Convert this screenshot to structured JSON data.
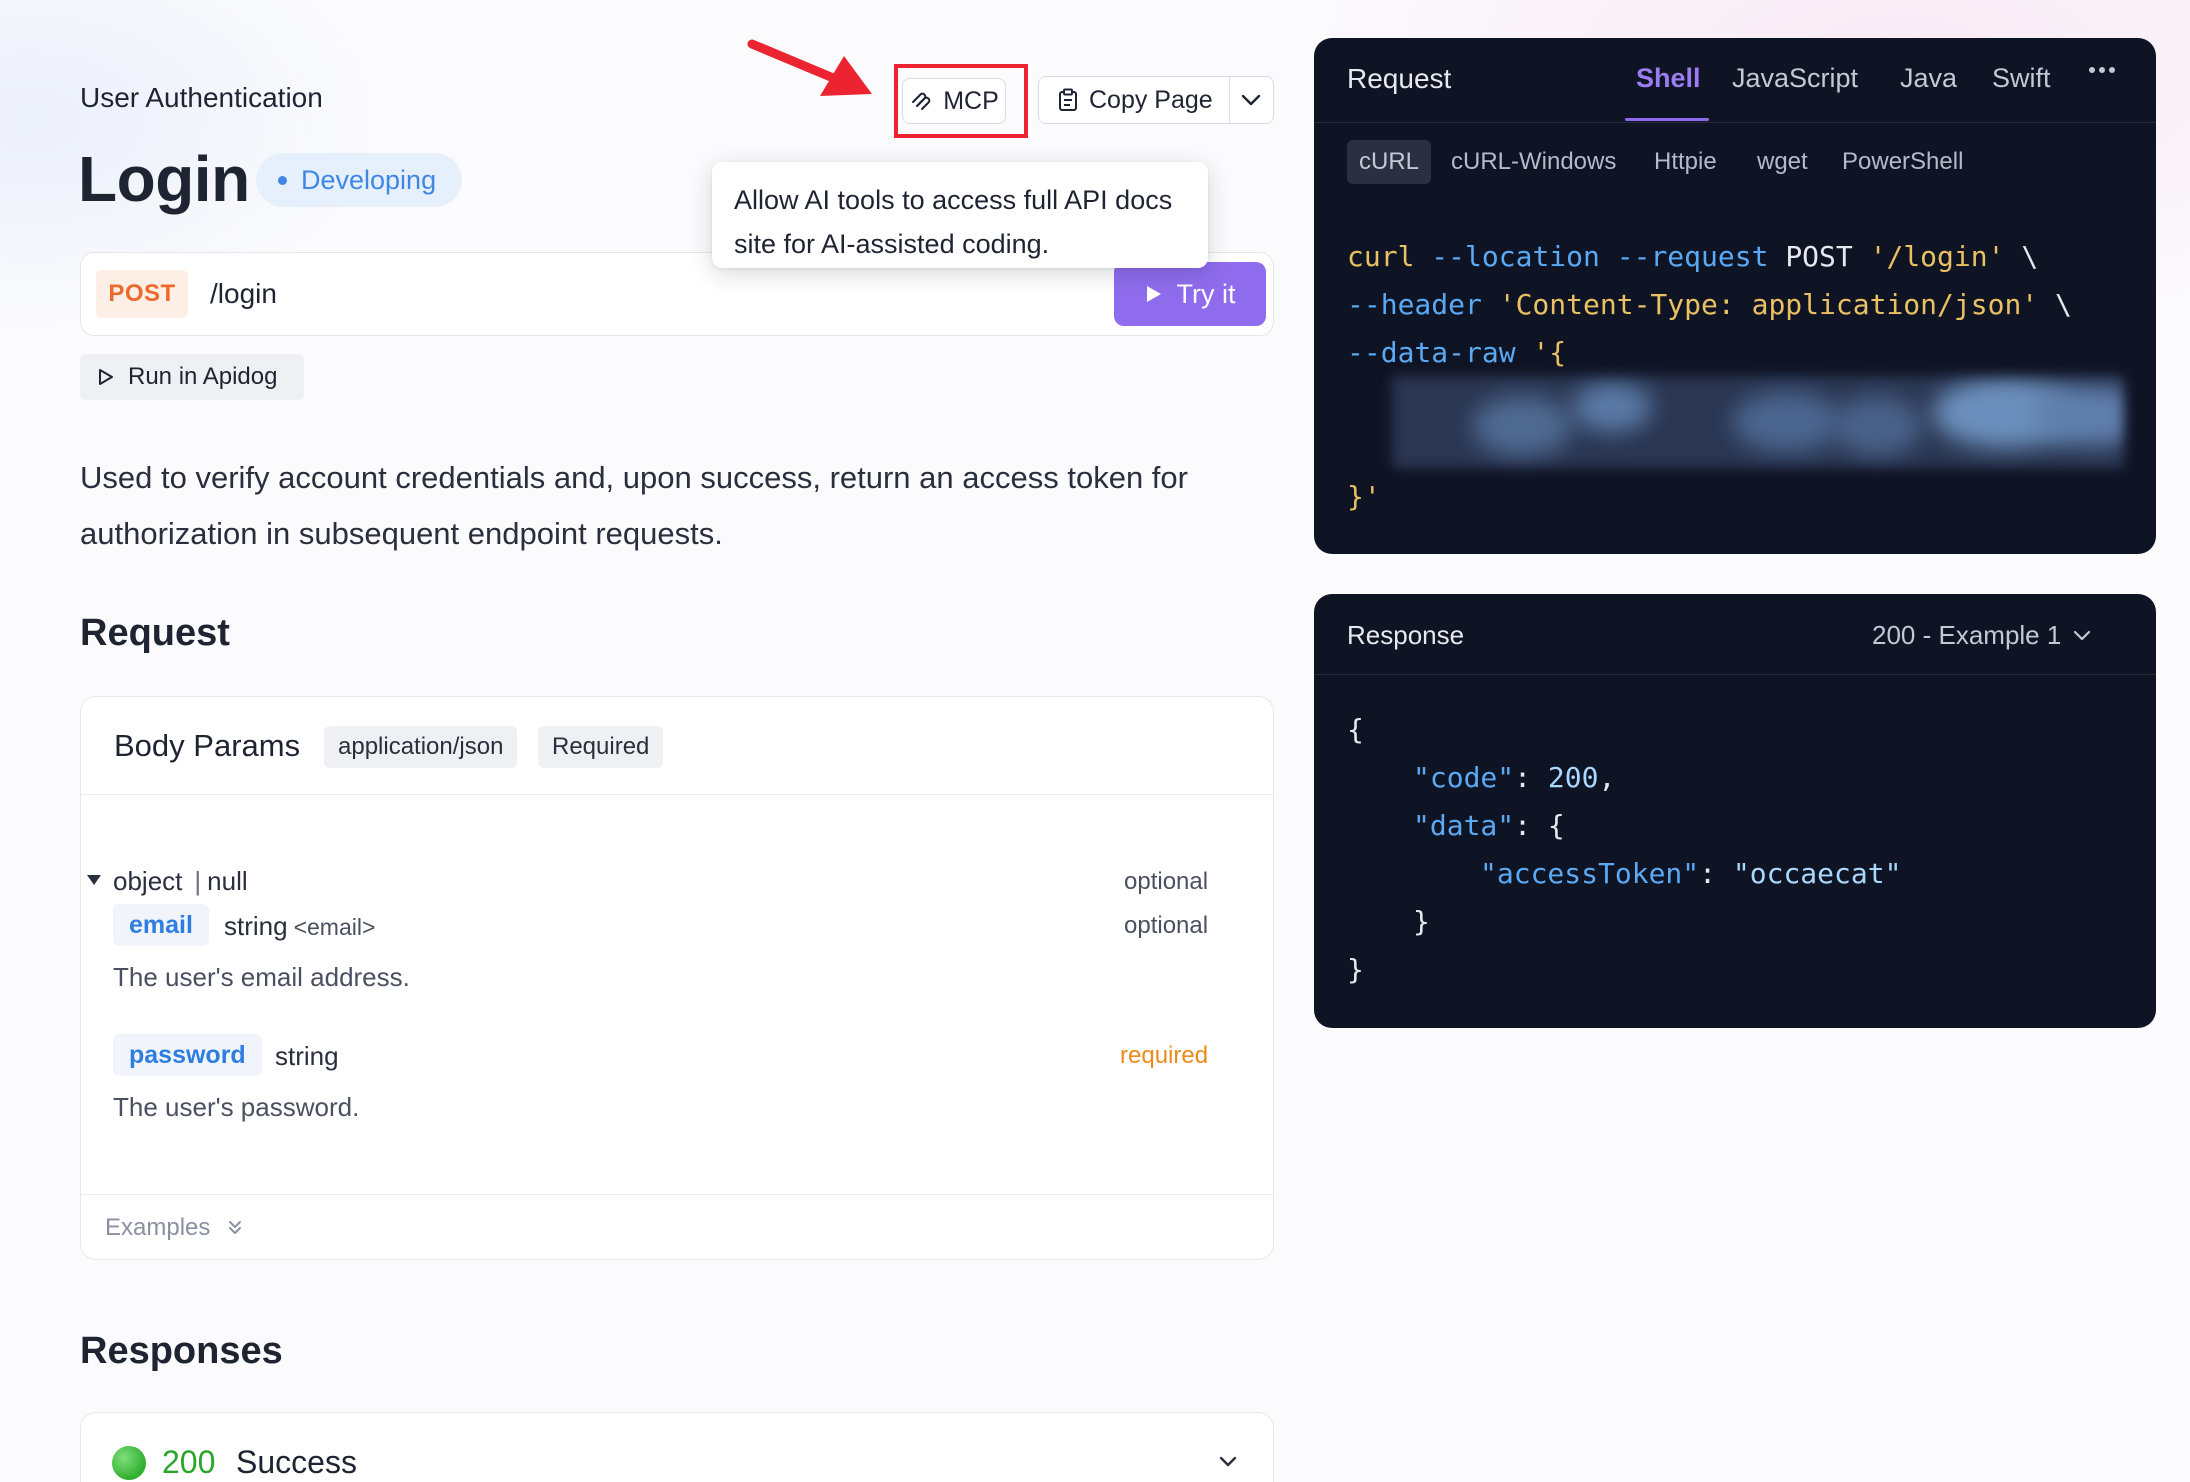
{
  "breadcrumb": "User Authentication",
  "page": {
    "title": "Login",
    "status": "Developing"
  },
  "toolbar": {
    "mcp_label": "MCP",
    "copy_label": "Copy Page"
  },
  "tooltip": {
    "line1": "Allow AI tools to access full API docs",
    "line2": "site for AI-assisted coding."
  },
  "endpoint": {
    "method": "POST",
    "path": "/login",
    "try_label": "Try it",
    "run_label": "Run in Apidog"
  },
  "description": "Used to verify account credentials and, upon success, return an access token for authorization in subsequent endpoint requests.",
  "request": {
    "heading": "Request",
    "body_params_title": "Body Params",
    "content_type": "application/json",
    "required_tag": "Required",
    "schema": {
      "type": "object",
      "nullable": "null",
      "optional_label": "optional"
    },
    "fields": [
      {
        "name": "email",
        "type": "string",
        "format": "<email>",
        "requirement": "optional",
        "description": "The user's email address."
      },
      {
        "name": "password",
        "type": "string",
        "format": "",
        "requirement": "required",
        "description": "The user's password."
      }
    ],
    "examples_label": "Examples"
  },
  "responses": {
    "heading": "Responses",
    "items": [
      {
        "code": "200",
        "label": "Success"
      }
    ]
  },
  "code_panel": {
    "title": "Request",
    "languages": [
      "Shell",
      "JavaScript",
      "Java",
      "Swift"
    ],
    "active_language": "Shell",
    "clients": [
      "cURL",
      "cURL-Windows",
      "Httpie",
      "wget",
      "PowerShell"
    ],
    "active_client": "cURL",
    "code": {
      "line1_cmd": "curl",
      "line1_flags": "--location --request",
      "line1_method": "POST",
      "line1_url": "'/login'",
      "line1_cont": "\\",
      "line2_flag": "--header",
      "line2_value": "'Content-Type: application/json'",
      "line2_cont": "\\",
      "line3_flag": "--data-raw",
      "line3_open": "'{",
      "line_close": "}'"
    }
  },
  "response_panel": {
    "title": "Response",
    "example_select": "200 - Example 1",
    "json": {
      "open": "{",
      "code_key": "\"code\"",
      "code_value": "200",
      "data_key": "\"data\"",
      "data_open": "{",
      "token_key": "\"accessToken\"",
      "token_value": "\"occaecat\"",
      "data_close": "}",
      "close": "}"
    }
  },
  "colors": {
    "accent": "#8f6ced",
    "method_post": "#ec6a2c",
    "status_developing": "#3f86e5",
    "required": "#ec8a1b",
    "success": "#2aa52a",
    "highlight_box": "#ec2431",
    "code_bg": "#0f1424"
  }
}
